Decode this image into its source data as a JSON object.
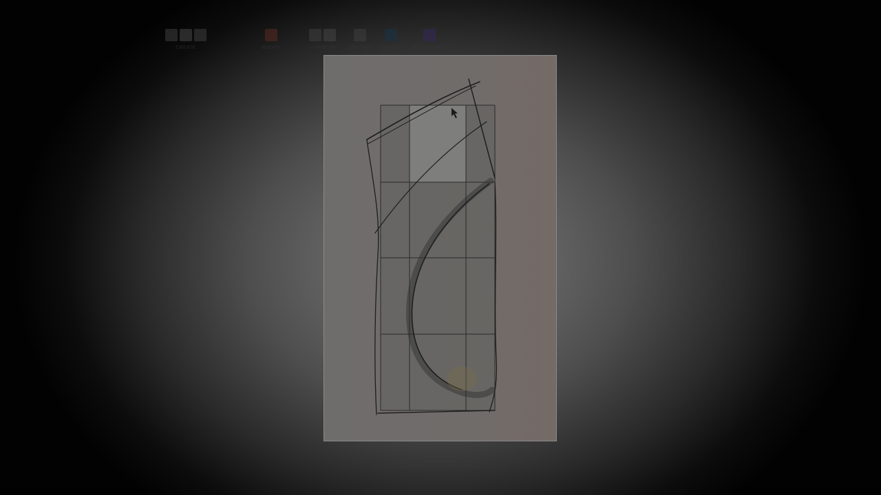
{
  "toolbar": {
    "groups": [
      {
        "label": "CREATE",
        "icons": [
          "box-icon",
          "plane-icon",
          "cylinder-icon"
        ],
        "color": "#3e3e3e"
      },
      {
        "label": "MODIFY",
        "icons": [
          "edit-form-icon"
        ],
        "color": "#5a2a22"
      },
      {
        "label": "SYMMETRY",
        "icons": [
          "mirror-icon",
          "symmetry-icon"
        ],
        "color": "#3e3e3e"
      },
      {
        "label": "UTILITIES",
        "icons": [
          "utilities-icon"
        ],
        "color": "#3e3e3e"
      },
      {
        "label": "SELECT",
        "icons": [
          "select-icon"
        ],
        "color": "#1a3347"
      },
      {
        "label": "FINISH FORM",
        "icons": [
          "finish-form-icon"
        ],
        "color": "#35285a"
      }
    ]
  },
  "navbar": {
    "icons": [
      "orbit-icon",
      "pan-icon",
      "zoom-icon",
      "fit-icon",
      "display-settings-icon",
      "grid-icon",
      "viewports-icon"
    ]
  },
  "colors": {
    "canvas_bg": "#706c6a",
    "mesh_fill": "#646461",
    "mesh_line": "#2a2a2a",
    "highlight_face": "#8e8e8e",
    "sketch_stroke": "#1e1e1e",
    "accent_brush": "#7a6e48"
  }
}
